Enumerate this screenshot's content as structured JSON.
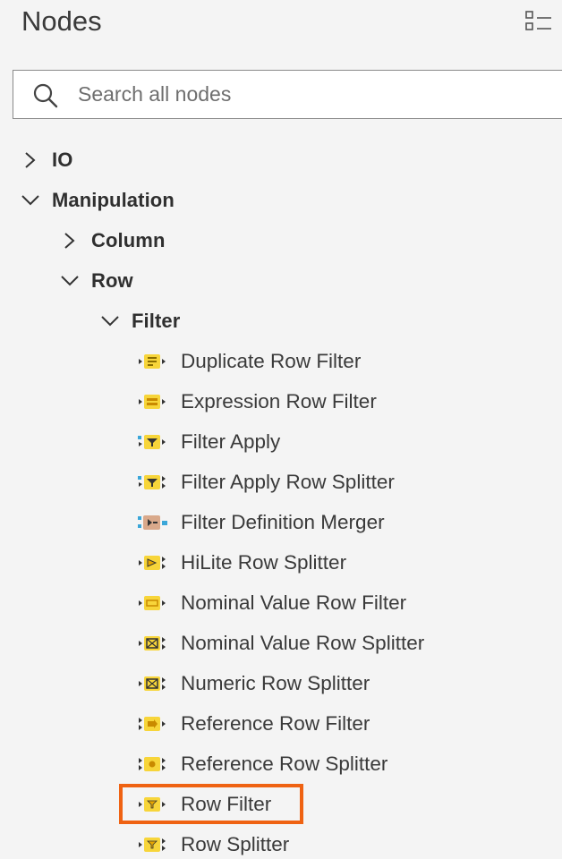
{
  "header": {
    "title": "Nodes",
    "view_toggle_icon": "list-view-icon"
  },
  "search": {
    "placeholder": "Search all nodes",
    "value": "",
    "icon": "search-icon"
  },
  "tree": {
    "io": {
      "label": "IO",
      "expanded": false
    },
    "manipulation": {
      "label": "Manipulation",
      "expanded": true
    },
    "column": {
      "label": "Column",
      "expanded": false
    },
    "row": {
      "label": "Row",
      "expanded": true
    },
    "filter": {
      "label": "Filter",
      "expanded": true
    },
    "nodes": [
      {
        "label": "Duplicate Row Filter",
        "icon": "duplicate-row-filter-icon"
      },
      {
        "label": "Expression Row Filter",
        "icon": "expression-row-filter-icon"
      },
      {
        "label": "Filter Apply",
        "icon": "filter-apply-icon"
      },
      {
        "label": "Filter Apply Row Splitter",
        "icon": "filter-apply-row-splitter-icon"
      },
      {
        "label": "Filter Definition Merger",
        "icon": "filter-definition-merger-icon"
      },
      {
        "label": "HiLite Row Splitter",
        "icon": "hilite-row-splitter-icon"
      },
      {
        "label": "Nominal Value Row Filter",
        "icon": "nominal-value-row-filter-icon"
      },
      {
        "label": "Nominal Value Row Splitter",
        "icon": "nominal-value-row-splitter-icon"
      },
      {
        "label": "Numeric Row Splitter",
        "icon": "numeric-row-splitter-icon"
      },
      {
        "label": "Reference Row Filter",
        "icon": "reference-row-filter-icon"
      },
      {
        "label": "Reference Row Splitter",
        "icon": "reference-row-splitter-icon"
      },
      {
        "label": "Row Filter",
        "icon": "row-filter-icon",
        "highlighted": true
      },
      {
        "label": "Row Splitter",
        "icon": "row-splitter-icon"
      }
    ]
  },
  "colors": {
    "node_yellow": "#f7d53a",
    "node_orange_accent": "#e8a700",
    "merger_tan": "#d9a98b",
    "merger_blue": "#3aa6d8",
    "highlight_border": "#ef6212"
  }
}
